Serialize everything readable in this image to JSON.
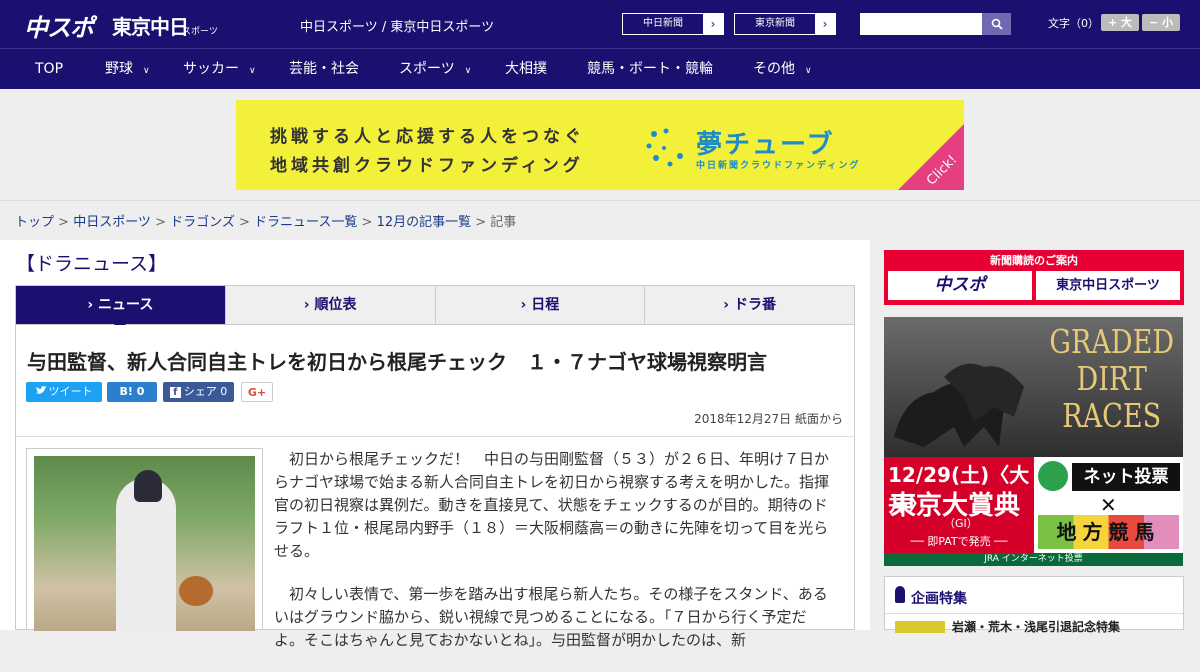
{
  "header": {
    "logo_chuspo": "中スポ",
    "logo_tokyo": "東京中日",
    "logo_tokyo_sub": "スポーツ",
    "site_title": "中日スポーツ / 東京中日スポーツ",
    "btn_chunichi": "中日新聞",
    "btn_tokyo": "東京新聞",
    "arrow": "›",
    "search_icon": "search-icon",
    "font_size_label": "文字（0）",
    "font_bigger": "+ 大",
    "font_smaller": "− 小"
  },
  "nav": {
    "items": [
      {
        "label": "TOP",
        "chev": ""
      },
      {
        "label": "野球",
        "chev": "∨"
      },
      {
        "label": "サッカー",
        "chev": "∨"
      },
      {
        "label": "芸能・社会",
        "chev": ""
      },
      {
        "label": "スポーツ",
        "chev": "∨"
      },
      {
        "label": "大相撲",
        "chev": ""
      },
      {
        "label": "競馬・ボート・競輪",
        "chev": ""
      },
      {
        "label": "その他",
        "chev": "∨"
      }
    ]
  },
  "banner": {
    "line1": "挑戦する人と応援する人をつなぐ",
    "line2": "地域共創クラウドファンディング",
    "brand": "夢チューブ",
    "brand_sub": "中日新聞クラウドファンディング",
    "click": "Click!"
  },
  "breadcrumb": {
    "items": [
      "トップ",
      "中日スポーツ",
      "ドラゴンズ",
      "ドラニュース一覧",
      "12月の記事一覧"
    ],
    "sep": " > ",
    "current": "記事"
  },
  "section_title": "【ドラニュース】",
  "tabs": [
    {
      "label": "› ニュース"
    },
    {
      "label": "› 順位表"
    },
    {
      "label": "› 日程"
    },
    {
      "label": "› ドラ番"
    }
  ],
  "article": {
    "title": "与田監督、新人合同自主トレを初日から根尾チェック　１・７ナゴヤ球場視察明言",
    "share_tweet": "ツイート",
    "share_hatena": "B! 0",
    "share_fb": "シェア 0",
    "share_gplus": "G+",
    "date": "2018年12月27日 紙面から",
    "paragraphs": [
      "初日から根尾チェックだ！　中日の与田剛監督（５３）が２６日、年明け７日からナゴヤ球場で始まる新人合同自主トレを初日から視察する考えを明かした。指揮官の初日視察は異例だ。動きを直接見て、状態をチェックするのが目的。期待のドラフト１位・根尾昂内野手（１８）＝大阪桐蔭高＝の動きに先陣を切って目を光らせる。",
      "初々しい表情で、第一歩を踏み出す根尾ら新人たち。その様子をスタンド、あるいはグラウンド脇から、鋭い視線で見つめることになる。「７日から行く予定だよ。そこはちゃんと見ておかないとね」。与田監督が明かしたのは、新"
    ]
  },
  "sidebar": {
    "subscribe_title": "新聞購読のご案内",
    "subscribe_a": "中スポ",
    "subscribe_b": "東京中日スポーツ",
    "race_title": "GRADED DIRT RACES",
    "race_date": "12/29(土)〈大井〉",
    "race_name": "東京大賞典",
    "race_grade": "（GⅠ）",
    "race_sale": "── 即PATで発売 ──",
    "race_net": "ネット投票",
    "race_local": "地方競馬",
    "race_jra": "JRA インターネット投票",
    "special_title": "企画特集",
    "special_item": "岩瀬・荒木・浅尾引退記念特集"
  }
}
